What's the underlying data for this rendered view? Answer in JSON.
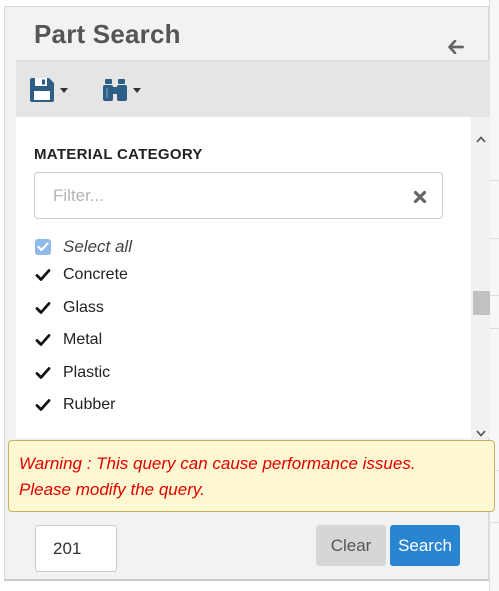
{
  "panel": {
    "title": "Part Search"
  },
  "toolbar": {
    "save_icon": "floppy-disk-icon",
    "search_icon": "binoculars-icon"
  },
  "filter": {
    "section_label": "MATERIAL CATEGORY",
    "placeholder": "Filter...",
    "value": ""
  },
  "select_all": {
    "label": "Select all",
    "checked": true
  },
  "materials": [
    {
      "label": "Concrete",
      "checked": true
    },
    {
      "label": "Glass",
      "checked": true
    },
    {
      "label": "Metal",
      "checked": true
    },
    {
      "label": "Plastic",
      "checked": true
    },
    {
      "label": "Rubber",
      "checked": true
    }
  ],
  "warning": {
    "line1": "Warning : This query can cause performance issues.",
    "line2": "Please modify the query."
  },
  "footer": {
    "count": "201",
    "clear_label": "Clear",
    "search_label": "Search"
  },
  "colors": {
    "accent": "#2a85d0",
    "warning_text": "#e00000",
    "warning_bg": "#fdf8d1"
  }
}
